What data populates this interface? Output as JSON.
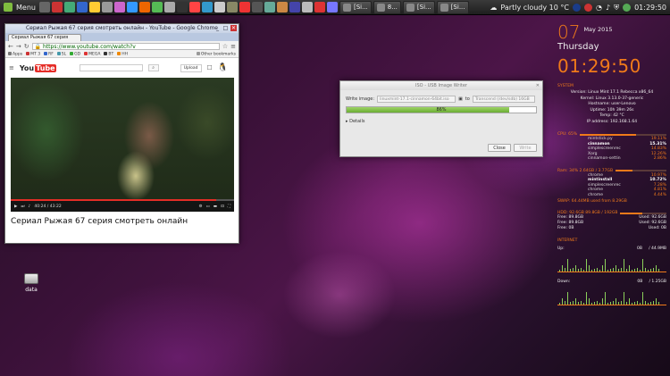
{
  "taskbar": {
    "menu_label": "Menu",
    "tasks": [
      "[Si...",
      "8...",
      "[Si...",
      "[Si..."
    ],
    "weather": "Partly cloudy 10 °C",
    "clock": "01:29:50",
    "quick_launch_colors": [
      "#666",
      "#c33",
      "#4a7",
      "#36c",
      "#fc3",
      "#999",
      "#c6c",
      "#39f",
      "#e60",
      "#5b5",
      "#aaa",
      "#333",
      "#f44",
      "#39c",
      "#ccc",
      "#886",
      "#e33",
      "#555",
      "#6a9",
      "#c84",
      "#44a",
      "#bbb",
      "#d33",
      "#77f"
    ]
  },
  "chrome": {
    "window_title": "Сериал Рыжая 67 серия смотреть онлайн - YouTube - Google Chrome",
    "tab_title": "Сериал Рыжая 67 серия",
    "url": "https://www.youtube.com/watch?v",
    "bookmarks": [
      "Apps",
      "MT 3",
      "RF",
      "SL",
      "GD",
      "MEGA",
      "BT",
      "HH",
      "Other bookmarks"
    ],
    "bookmark_colors": [
      "#777",
      "#c33",
      "#36c",
      "#49a",
      "#3a3",
      "#d33",
      "#333",
      "#e80",
      "#999"
    ],
    "yt_logo_you": "You",
    "yt_logo_tube": "Tube",
    "yt_upload": "Upload",
    "video_time": "40:24 / 43:22",
    "video_progress": 0.92,
    "video_title": "Сериал Рыжая 67 серия смотреть онлайн"
  },
  "usb_writer": {
    "title": "ISO - USB Image Writer",
    "write_image_label": "Write image:",
    "image_value": "linuxmint-17.1-cinnamon-64bit.iso",
    "to_label": "to",
    "device_value": "Transcend (/dev/sdb) 16GB",
    "progress_pct": 0.86,
    "progress_label": "86%",
    "details_label": "Details",
    "close_label": "Close",
    "write_label": "Write"
  },
  "desktop": {
    "icon_label": "data"
  },
  "conky": {
    "day": "07",
    "month_year": "May 2015",
    "weekday": "Thursday",
    "time": "01:29:50",
    "system_header": "SYSTEM",
    "system_lines": [
      "Version: Linux Mint 17.1 Rebecca x86_64",
      "Kernel: Linux 3.13.0-37-generic",
      "Hostname: user-Lenovo",
      "Uptime: 10h 39m 26s",
      "Temp: 42 °C",
      "IP address: 192.168.1.64"
    ],
    "cpu_header": "CPU: 65%",
    "cpu_pct": 0.65,
    "cpu_procs": [
      {
        "name": "mintstick.py",
        "value": "19.11%",
        "hl": false
      },
      {
        "name": "cinnamon",
        "value": "15.31%",
        "hl": true
      },
      {
        "name": "simplescreenrec",
        "value": "14.83%",
        "hl": false
      },
      {
        "name": "Xorg",
        "value": "12.26%",
        "hl": false
      },
      {
        "name": "cinnamon-settin",
        "value": "2.86%",
        "hl": false
      }
    ],
    "ram_header": "Ram: 34% 2.64GB / 3.77GB",
    "ram_pct": 0.34,
    "ram_procs": [
      {
        "name": "chrome",
        "value": "10.97%",
        "hl": false
      },
      {
        "name": "mintinstall",
        "value": "10.72%",
        "hl": true
      },
      {
        "name": "simplescreenrec",
        "value": "7.28%",
        "hl": false
      },
      {
        "name": "chrome",
        "value": "4.81%",
        "hl": false
      },
      {
        "name": "chrome",
        "value": "4.44%",
        "hl": false
      }
    ],
    "swap_line": "SWAP: 64.44MB used from 8.29GB",
    "hdd_header": "HDD: 92.6GB 89.8GB / 192GB",
    "hdd_pct": 0.48,
    "hdd_rows": [
      {
        "left": "Free: 89.8GB",
        "right": "Used: 92.6GB"
      },
      {
        "left": "Free: 89.8GB",
        "right": "Used: 92.6GB"
      },
      {
        "left": "Free: 0B",
        "right": "Used: 0B"
      }
    ],
    "internet_header": "INTERNET",
    "up_label": "Up:",
    "up_rate": "0B",
    "up_total": "/ 44.9MB",
    "down_label": "Down:",
    "down_rate": "0B",
    "down_total": "/ 1.25GB"
  }
}
